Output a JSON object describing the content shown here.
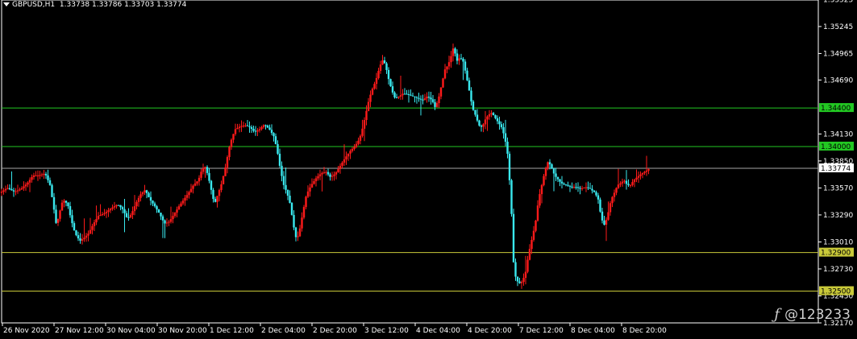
{
  "header": {
    "symbol": "GBPUSD,H1",
    "ohlc": "1.33738 1.33786 1.33703 1.33774"
  },
  "watermark": {
    "logo": "ƒ",
    "text": "@123233"
  },
  "colors": {
    "bull": "#ff1a1a",
    "bear": "#39e8ee",
    "axis": "#ffffff",
    "level_green": "#22c822",
    "level_yellow": "#c9c939",
    "last_line": "#a6a6a6"
  },
  "chart_data": {
    "type": "candlestick",
    "title": "GBPUSD,H1",
    "ylim": [
      1.3217,
      1.3552
    ],
    "y_ticks": [
      "1.35525",
      "1.35245",
      "1.34965",
      "1.34690",
      "1.34130",
      "1.33850",
      "1.33570",
      "1.33290",
      "1.33010",
      "1.32730",
      "1.32450",
      "1.32170"
    ],
    "x_ticks": [
      "26 Nov 2020",
      "27 Nov 12:00",
      "30 Nov 04:00",
      "30 Nov 20:00",
      "1 Dec 12:00",
      "2 Dec 04:00",
      "2 Dec 20:00",
      "3 Dec 12:00",
      "4 Dec 04:00",
      "4 Dec 20:00",
      "7 Dec 12:00",
      "8 Dec 04:00",
      "8 Dec 20:00"
    ],
    "levels": [
      {
        "value": 1.344,
        "label": "1.34400",
        "color": "green"
      },
      {
        "value": 1.34,
        "label": "1.34000",
        "color": "green"
      },
      {
        "value": 1.329,
        "label": "1.32900",
        "color": "yellow"
      },
      {
        "value": 1.325,
        "label": "1.32500",
        "color": "yellow"
      }
    ],
    "last_price": {
      "value": 1.33774,
      "label": "1.33774"
    },
    "path": [
      [
        0,
        1.3352
      ],
      [
        9,
        1.3357
      ],
      [
        18,
        1.3353
      ],
      [
        26,
        1.3356
      ],
      [
        34,
        1.3362
      ],
      [
        41,
        1.337
      ],
      [
        48,
        1.337
      ],
      [
        56,
        1.3372
      ],
      [
        62,
        1.336
      ],
      [
        66,
        1.334
      ],
      [
        70,
        1.3318
      ],
      [
        74,
        1.3332
      ],
      [
        78,
        1.3345
      ],
      [
        84,
        1.334
      ],
      [
        88,
        1.3325
      ],
      [
        93,
        1.331
      ],
      [
        99,
        1.3302
      ],
      [
        104,
        1.3305
      ],
      [
        110,
        1.331
      ],
      [
        116,
        1.332
      ],
      [
        122,
        1.3328
      ],
      [
        130,
        1.3331
      ],
      [
        138,
        1.3336
      ],
      [
        146,
        1.334
      ],
      [
        152,
        1.3335
      ],
      [
        158,
        1.3325
      ],
      [
        163,
        1.333
      ],
      [
        168,
        1.334
      ],
      [
        174,
        1.335
      ],
      [
        180,
        1.3355
      ],
      [
        186,
        1.3345
      ],
      [
        192,
        1.3338
      ],
      [
        198,
        1.333
      ],
      [
        204,
        1.332
      ],
      [
        210,
        1.3322
      ],
      [
        216,
        1.333
      ],
      [
        222,
        1.3338
      ],
      [
        228,
        1.3345
      ],
      [
        234,
        1.3352
      ],
      [
        240,
        1.336
      ],
      [
        246,
        1.3365
      ],
      [
        250,
        1.3375
      ],
      [
        254,
        1.338
      ],
      [
        258,
        1.337
      ],
      [
        262,
        1.3355
      ],
      [
        266,
        1.334
      ],
      [
        270,
        1.335
      ],
      [
        275,
        1.3362
      ],
      [
        280,
        1.338
      ],
      [
        284,
        1.3398
      ],
      [
        288,
        1.341
      ],
      [
        292,
        1.3418
      ],
      [
        298,
        1.3421
      ],
      [
        304,
        1.3422
      ],
      [
        310,
        1.342
      ],
      [
        316,
        1.3415
      ],
      [
        322,
        1.3418
      ],
      [
        328,
        1.3423
      ],
      [
        334,
        1.3418
      ],
      [
        340,
        1.341
      ],
      [
        344,
        1.3395
      ],
      [
        348,
        1.3375
      ],
      [
        352,
        1.336
      ],
      [
        356,
        1.3352
      ],
      [
        360,
        1.334
      ],
      [
        364,
        1.3318
      ],
      [
        368,
        1.3302
      ],
      [
        372,
        1.3315
      ],
      [
        376,
        1.3333
      ],
      [
        380,
        1.335
      ],
      [
        386,
        1.336
      ],
      [
        392,
        1.3367
      ],
      [
        398,
        1.3372
      ],
      [
        404,
        1.3374
      ],
      [
        410,
        1.3368
      ],
      [
        416,
        1.3372
      ],
      [
        422,
        1.338
      ],
      [
        428,
        1.3388
      ],
      [
        434,
        1.3395
      ],
      [
        440,
        1.34
      ],
      [
        446,
        1.3408
      ],
      [
        450,
        1.342
      ],
      [
        454,
        1.3435
      ],
      [
        458,
        1.345
      ],
      [
        462,
        1.346
      ],
      [
        466,
        1.3468
      ],
      [
        470,
        1.348
      ],
      [
        474,
        1.349
      ],
      [
        478,
        1.3485
      ],
      [
        482,
        1.347
      ],
      [
        486,
        1.3458
      ],
      [
        490,
        1.345
      ],
      [
        495,
        1.3452
      ],
      [
        500,
        1.3455
      ],
      [
        506,
        1.3454
      ],
      [
        512,
        1.3452
      ],
      [
        518,
        1.345
      ],
      [
        524,
        1.3448
      ],
      [
        530,
        1.3452
      ],
      [
        536,
        1.3448
      ],
      [
        540,
        1.344
      ],
      [
        544,
        1.345
      ],
      [
        548,
        1.3465
      ],
      [
        552,
        1.348
      ],
      [
        556,
        1.3485
      ],
      [
        560,
        1.3495
      ],
      [
        563,
        1.3505
      ],
      [
        566,
        1.3488
      ],
      [
        570,
        1.3492
      ],
      [
        574,
        1.349
      ],
      [
        578,
        1.3475
      ],
      [
        582,
        1.3458
      ],
      [
        586,
        1.344
      ],
      [
        590,
        1.3432
      ],
      [
        594,
        1.3422
      ],
      [
        598,
        1.342
      ],
      [
        602,
        1.3428
      ],
      [
        606,
        1.3433
      ],
      [
        610,
        1.3435
      ],
      [
        614,
        1.343
      ],
      [
        618,
        1.3425
      ],
      [
        622,
        1.342
      ],
      [
        626,
        1.341
      ],
      [
        630,
        1.339
      ],
      [
        634,
        1.334
      ],
      [
        637,
        1.328
      ],
      [
        640,
        1.3262
      ],
      [
        644,
        1.3258
      ],
      [
        648,
        1.326
      ],
      [
        652,
        1.327
      ],
      [
        656,
        1.329
      ],
      [
        660,
        1.3305
      ],
      [
        664,
        1.332
      ],
      [
        668,
        1.3345
      ],
      [
        672,
        1.336
      ],
      [
        676,
        1.3375
      ],
      [
        680,
        1.3385
      ],
      [
        684,
        1.3378
      ],
      [
        688,
        1.337
      ],
      [
        692,
        1.3366
      ],
      [
        696,
        1.3362
      ],
      [
        702,
        1.336
      ],
      [
        708,
        1.3358
      ],
      [
        714,
        1.3358
      ],
      [
        720,
        1.3356
      ],
      [
        726,
        1.3358
      ],
      [
        732,
        1.3356
      ],
      [
        738,
        1.3352
      ],
      [
        742,
        1.3345
      ],
      [
        746,
        1.3325
      ],
      [
        750,
        1.3318
      ],
      [
        754,
        1.333
      ],
      [
        758,
        1.3345
      ],
      [
        762,
        1.3352
      ],
      [
        766,
        1.336
      ],
      [
        770,
        1.3362
      ],
      [
        774,
        1.3365
      ],
      [
        778,
        1.336
      ],
      [
        782,
        1.336
      ],
      [
        786,
        1.3365
      ],
      [
        790,
        1.3368
      ],
      [
        796,
        1.3372
      ],
      [
        802,
        1.3375
      ],
      [
        806,
        1.33774
      ]
    ]
  }
}
